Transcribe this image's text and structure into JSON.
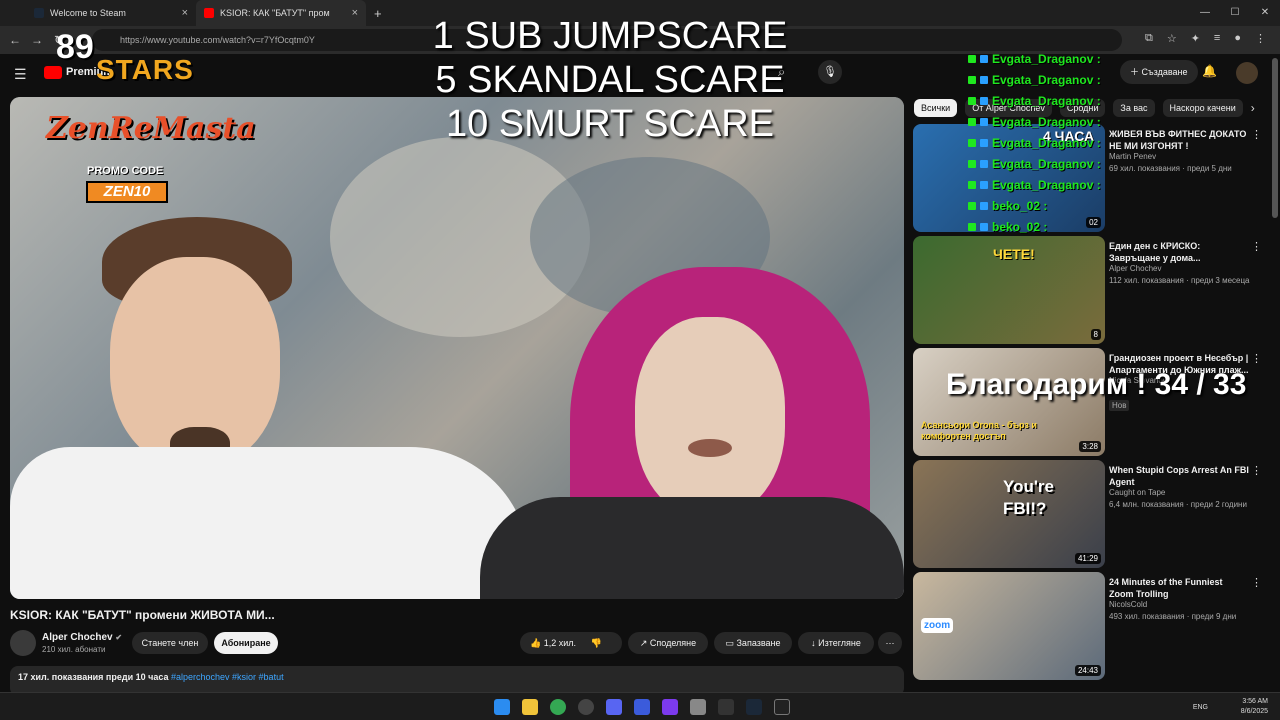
{
  "browser": {
    "tabs": [
      {
        "label": "Welcome to Steam"
      },
      {
        "label": "KSIOR: КАК \"БАТУТ\" проме"
      }
    ],
    "url": "https://www.youtube.com/watch?v=r7YfOcqtm0Y"
  },
  "youtube": {
    "logo_text": "Premium",
    "create_label": "Създаване",
    "chips": [
      "Всички",
      "От Alper Chochev",
      "Сродни",
      "За вас",
      "Наскоро качени"
    ]
  },
  "video": {
    "title": "KSIOR: КАК \"БАТУТ\" промени ЖИВОТА МИ...",
    "channel": "Alper Chochev",
    "subscribers": "210 хил. абонати",
    "join_label": "Станете член",
    "subscribe_label": "Абониране",
    "likes": "1,2 хил.",
    "share_label": "Споделяне",
    "save_label": "Запазване",
    "download_label": "Изтегляне",
    "views_date": "17 хил. показвания  преди 10 часа",
    "tags": "#alperchochev #ksior #batut",
    "overlay": {
      "zen_text": "ZenReMasta",
      "promo_code": "PROMO CODE",
      "promo_value": "ZEN10",
      "stars_num": "89",
      "stars_text": "STARS",
      "scare_lines": [
        "1 SUB JUMPSCARE",
        "5 SKANDAL SCARE",
        "10 SMURT SCARE"
      ]
    }
  },
  "chat": [
    {
      "user": "Evgata_Draganov :"
    },
    {
      "user": "Evgata_Draganov :"
    },
    {
      "user": "Evgata_Draganov :"
    },
    {
      "user": "Evgata_Draganov :"
    },
    {
      "user": "Evgata_Draganov :"
    },
    {
      "user": "Evgata_Draganov :"
    },
    {
      "user": "Evgata_Draganov :"
    },
    {
      "user": "beko_02 :"
    },
    {
      "user": "beko_02 :"
    }
  ],
  "thanks_overlay": "Благодарим ! 34 / 33",
  "recommended": [
    {
      "title": "ЖИВЕЯ ВЪВ ФИТНЕС ДОКАТО НЕ МИ ИЗГОНЯТ !",
      "channel": "Martin Penev",
      "meta": "69 хил. показвания · преди 5 дни",
      "duration": "02",
      "thumb_label": "4 ЧАСА"
    },
    {
      "title": "Един ден с КРИСКО: Завръщане у дома...",
      "channel": "Alper Chochev",
      "meta": "112 хил. показвания · преди 3 месеца",
      "duration": "8",
      "thumb_label": "ЧЕТЕ!"
    },
    {
      "title": "Грандиозен проект в Несебър | Апартаменти до Южния плаж...",
      "channel": "Nicola Stovanov",
      "meta": "Нов",
      "duration": "3:28",
      "thumb_label": "Асансьори Orona - бърз и комфортен достъп"
    },
    {
      "title": "When Stupid Cops Arrest An FBI Agent",
      "channel": "Caught on Tape",
      "meta": "6,4 млн. показвания · преди 2 години",
      "duration": "41:29",
      "thumb_label": "You're FBI!?"
    },
    {
      "title": "24 Minutes of the Funniest Zoom Trolling",
      "channel": "NicolsCold",
      "meta": "493 хил. показвания · преди 9 дни",
      "duration": "24:43",
      "thumb_label": "zoom"
    }
  ],
  "taskbar": {
    "lang": "ENG",
    "time": "3:56 AM",
    "date": "8/6/2025"
  },
  "colors": {
    "accent_red": "#ff0000",
    "chat_green": "#1fe81f",
    "stars_gold": "#f1a71f"
  }
}
